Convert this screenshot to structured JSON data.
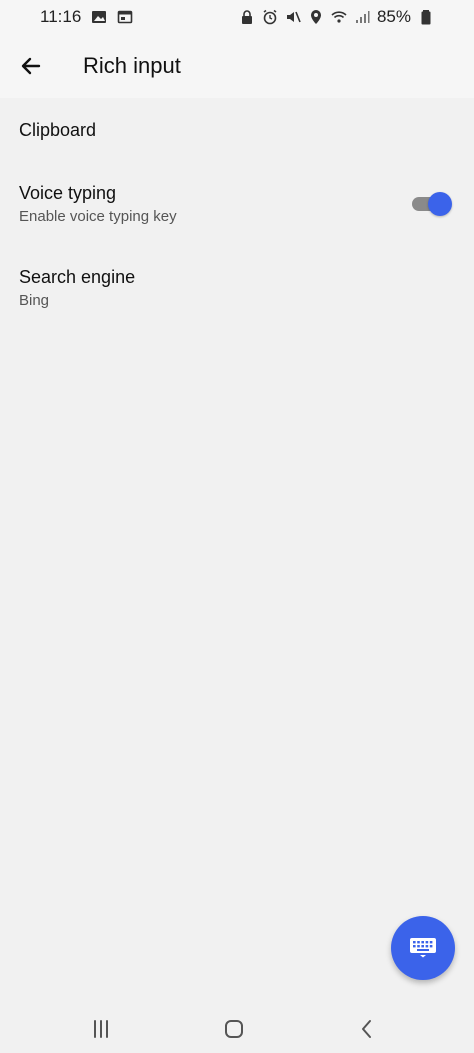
{
  "status_bar": {
    "time": "11:16",
    "battery_text": "85%",
    "left_icons": [
      "image-icon",
      "calendar-icon"
    ],
    "right_icons": [
      "lock-icon",
      "alarm-icon",
      "mute-icon",
      "location-icon",
      "wifi-icon",
      "signal-icon",
      "battery-icon"
    ]
  },
  "app_bar": {
    "title": "Rich input",
    "back_icon": "arrow-left-icon"
  },
  "preferences": [
    {
      "title": "Clipboard"
    },
    {
      "title": "Voice typing",
      "summary": "Enable voice typing key",
      "toggle_on": true
    },
    {
      "title": "Search engine",
      "summary": "Bing"
    }
  ],
  "fab": {
    "icon": "keyboard-icon"
  },
  "nav_bar": {
    "icons": [
      "recents-icon",
      "home-icon",
      "back-icon"
    ]
  },
  "colors": {
    "accent": "#3b63ea",
    "background": "#f1f1f1",
    "toggle_track": "#8a8a8a"
  }
}
